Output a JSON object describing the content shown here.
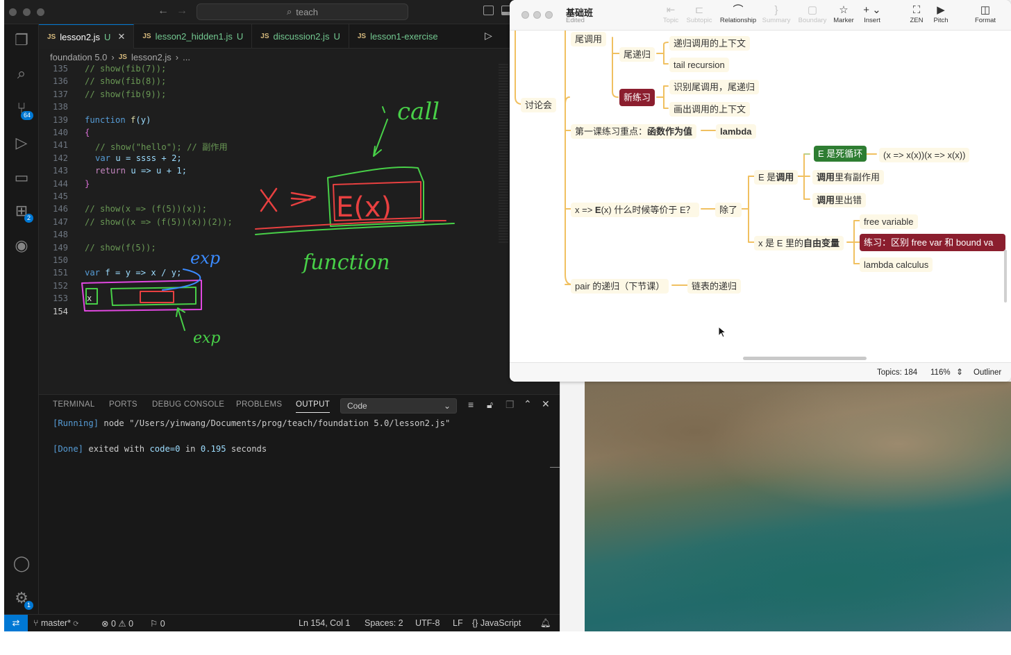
{
  "vscode": {
    "search": "teach",
    "tabs": [
      {
        "file": "lesson2.js",
        "status": "U",
        "close": "✕"
      },
      {
        "file": "lesson2_hidden1.js",
        "status": "U"
      },
      {
        "file": "discussion2.js",
        "status": "U"
      },
      {
        "file": "lesson1-exercise"
      }
    ],
    "breadcrumb": {
      "folder": "foundation 5.0",
      "file": "lesson2.js",
      "more": "..."
    },
    "source_control_badge": "64",
    "extensions_badge": "2",
    "settings_badge": "1",
    "line_numbers": [
      "135",
      "136",
      "137",
      "138",
      "139",
      "140",
      "141",
      "142",
      "143",
      "144",
      "145",
      "146",
      "147",
      "148",
      "149",
      "150",
      "151",
      "152",
      "153",
      "154"
    ],
    "code": {
      "l135": "// show(fib(7));",
      "l136": "// show(fib(8));",
      "l137": "// show(fib(9));",
      "l139_kw": "function",
      "l139_fn": "f",
      "l139_rest": "(y)",
      "l140": "{",
      "l141": "// show(\"hello\"); // 副作用",
      "l142_kw": "var",
      "l142_rest": "u = ssss + 2;",
      "l143_kw": "return",
      "l143_rest": "u => u + 1;",
      "l144": "}",
      "l146": "// show(x => (f(5))(x));",
      "l147": "// show((x => (f(5))(x))(2));",
      "l149": "// show(f(5));",
      "l151_kw": "var",
      "l151_rest": "f = y => x / y;"
    },
    "annotations": {
      "call": "call",
      "x": "x",
      "E": "E(x)",
      "function": "function",
      "exp1": "exp",
      "exp2": "exp"
    },
    "panel": {
      "tabs": [
        "TERMINAL",
        "PORTS",
        "DEBUG CONSOLE",
        "PROBLEMS",
        "OUTPUT"
      ],
      "active_tab": "OUTPUT",
      "select_value": "Code",
      "running_tag": "[Running]",
      "running_cmd": "node \"/Users/yinwang/Documents/prog/teach/foundation 5.0/lesson2.js\"",
      "done_tag": "[Done]",
      "done_text_a": "exited with",
      "done_code": "code=0",
      "done_text_b": "in",
      "done_time": "0.195",
      "done_text_c": "seconds"
    },
    "status": {
      "branch": "master*",
      "errors": "0",
      "warnings": "0",
      "ports": "0",
      "position": "Ln 154, Col 1",
      "spaces": "Spaces: 2",
      "encoding": "UTF-8",
      "eol": "LF",
      "language": "JavaScript"
    }
  },
  "xmind": {
    "title": "基础班",
    "subtitle": "Edited",
    "toolbar": [
      {
        "label": "Topic",
        "icon": "topic-icon",
        "enabled": false
      },
      {
        "label": "Subtopic",
        "icon": "subtopic-icon",
        "enabled": false
      },
      {
        "label": "Relationship",
        "icon": "relationship-icon",
        "enabled": true
      },
      {
        "label": "Summary",
        "icon": "summary-icon",
        "enabled": false
      },
      {
        "label": "Boundary",
        "icon": "boundary-icon",
        "enabled": false
      },
      {
        "label": "Marker",
        "icon": "star-icon",
        "enabled": true
      },
      {
        "label": "Insert",
        "icon": "plus-icon",
        "enabled": true
      },
      {
        "label": "ZEN",
        "icon": "zen-icon",
        "enabled": true
      },
      {
        "label": "Pitch",
        "icon": "pitch-icon",
        "enabled": true
      },
      {
        "label": "Format",
        "icon": "format-icon",
        "enabled": true
      }
    ],
    "nodes": {
      "tail_call": "尾调用",
      "tail_rec": "尾递归",
      "rec_context": "递归调用的上下文",
      "tail_recursion": "tail recursion",
      "new_exercise": "新练习",
      "identify": "识别尾调用，尾递归",
      "draw_context": "画出调用的上下文",
      "discussion": "讨论会",
      "lesson1_focus": "第一课练习重点：",
      "lesson1_focus_bold": "函数作为值",
      "lambda": "lambda",
      "e_loop": "E 是死循环",
      "loop_expr": "(x => x(x))(x => x(x))",
      "e_call_a": "E 是",
      "e_call_b": "调用",
      "call_side_a": "调用",
      "call_side_b": "里有副作用",
      "call_err_a": "调用",
      "call_err_b": "里出错",
      "question_a": "x => ",
      "question_b": "E",
      "question_c": "(x) 什么时候等价于 E？",
      "except": "除了",
      "free_var_node_a": "x 是 E 里的",
      "free_var_node_b": "自由变量",
      "free_variable": "free variable",
      "exercise_free": "练习：区别 free var 和 bound va",
      "lambda_calculus": "lambda calculus",
      "pair_rec": "pair 的递归（下节课）",
      "linked_list": "链表的递归"
    },
    "status": {
      "topics": "Topics: 184",
      "zoom": "116%",
      "outliner": "Outliner"
    }
  }
}
